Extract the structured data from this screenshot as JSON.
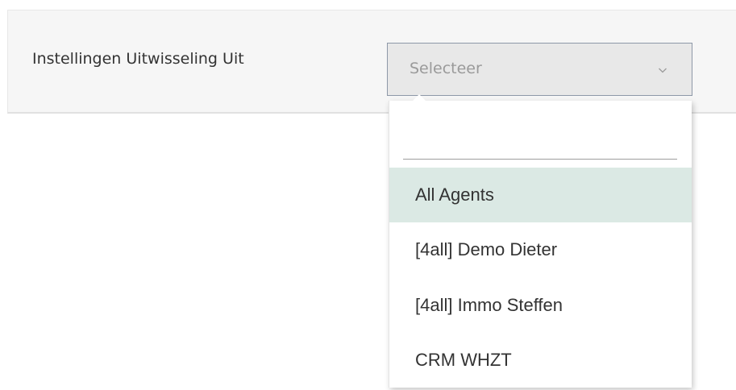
{
  "settings": {
    "label": "Instellingen Uitwisseling Uit",
    "select": {
      "placeholder": "Selecteer",
      "chevron_icon": "chevron-down-icon"
    }
  },
  "dropdown": {
    "search_value": "",
    "options": [
      {
        "label": "All Agents",
        "highlighted": true
      },
      {
        "label": "[4all] Demo Dieter",
        "highlighted": false
      },
      {
        "label": "[4all] Immo Steffen",
        "highlighted": false
      },
      {
        "label": "CRM WHZT",
        "highlighted": false
      }
    ]
  },
  "colors": {
    "highlight": "#dbe9e4",
    "select_border": "#8e98a8",
    "panel_background": "#f6f6f6"
  }
}
